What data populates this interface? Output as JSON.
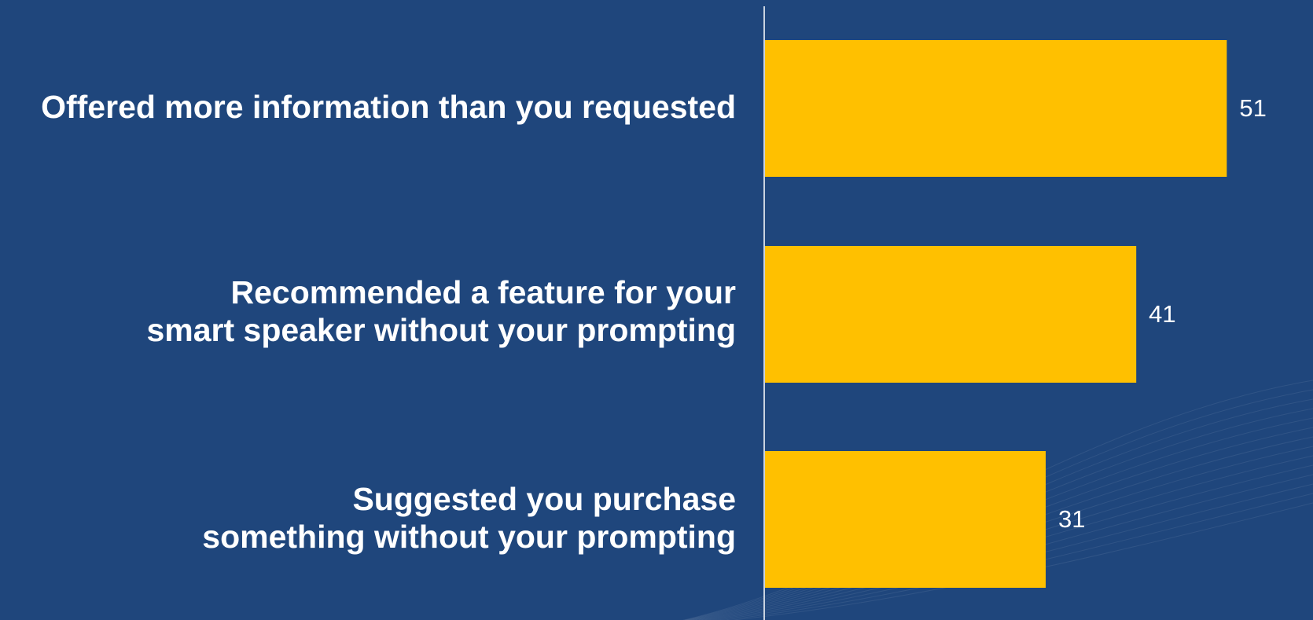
{
  "colors": {
    "background": "#1f467c",
    "bar": "#ffc000",
    "axis": "#c9d3e0",
    "text": "#ffffff"
  },
  "chart_data": {
    "type": "bar",
    "orientation": "horizontal",
    "categories": [
      "Offered more information than you requested",
      "Recommended a feature for your\nsmart speaker without your prompting",
      "Suggested you purchase\nsomething without your prompting"
    ],
    "values": [
      51,
      41,
      31
    ],
    "data_labels": [
      "51",
      "41",
      "31"
    ],
    "xlim": [
      0,
      60
    ],
    "grid": false,
    "title": "",
    "xlabel": "",
    "ylabel": ""
  }
}
